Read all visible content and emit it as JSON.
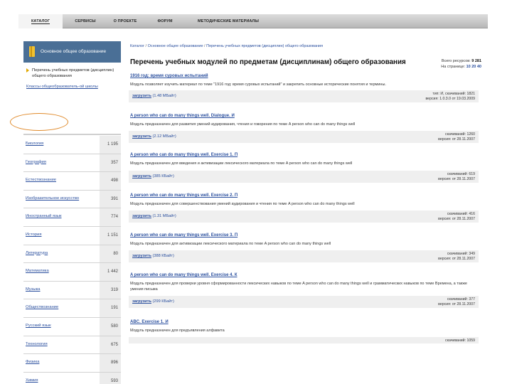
{
  "nav": {
    "tabs": [
      {
        "label": "КАТАЛОГ",
        "active": true
      },
      {
        "label": "СЕРВИСЫ",
        "active": false
      },
      {
        "label": "О ПРОЕКТЕ",
        "active": false
      },
      {
        "label": "ФОРУМ",
        "active": false
      },
      {
        "label": "МЕТОДИЧЕСКИЕ МАТЕРИАЛЫ",
        "active": false
      }
    ]
  },
  "sidebar": {
    "header": "Основное общее образование",
    "subitem": "Перечень учебных предметов (дисциплин) общего образования",
    "link": "Классы общеобразователь-ой школы",
    "subjects": [
      {
        "name": "Биология",
        "count": "1 195"
      },
      {
        "name": "География",
        "count": "357"
      },
      {
        "name": "Естествознание",
        "count": "498"
      },
      {
        "name": "Изобразительное искусство",
        "count": "391"
      },
      {
        "name": "Иностранный язык",
        "count": "774"
      },
      {
        "name": "История",
        "count": "1 151"
      },
      {
        "name": "Литература",
        "count": "80"
      },
      {
        "name": "Математика",
        "count": "1 442"
      },
      {
        "name": "Музыка",
        "count": "319"
      },
      {
        "name": "Обществознание",
        "count": "191"
      },
      {
        "name": "Русский язык",
        "count": "580"
      },
      {
        "name": "Технология",
        "count": "675"
      },
      {
        "name": "Физика",
        "count": "896"
      },
      {
        "name": "Химия",
        "count": "593"
      }
    ]
  },
  "breadcrumb": [
    "Каталог",
    "Основное общее образование",
    "Перечень учебных предметов (дисциплин) общего образования"
  ],
  "page_title": "Перечень учебных модулей по предметам (дисциплинам) общего образования",
  "stats": {
    "total_label": "Всего ресурсов:",
    "total": "9 281",
    "per_page_label": "На странице:",
    "p10": "10",
    "p20": "20",
    "p40": "40"
  },
  "items": [
    {
      "title": "1916 год: время суровых испытаний",
      "desc": "Модуль позволяет изучить материал по теме \"1916 год: время суровых испытаний\" и закрепить основные исторические понятия и термины.",
      "download": "загрузить",
      "size": "(1.48 МБайт)",
      "meta1": "тип: И, скачиваний: 1821",
      "meta2": "версия: 1.0.3.0 от 19.03.2009"
    },
    {
      "title": "A person who can do many things well. Dialogue. И",
      "desc": "Модуль предназначен для развития умений аудирования, чтения и говорения по теме A person who can do many things well",
      "download": "загрузить",
      "size": "(2.12 МБайт)",
      "meta1": "скачиваний: 1260",
      "meta2": "версия: от 28.11.2007"
    },
    {
      "title": "A person who can do many things well. Exercise 1. П",
      "desc": "Модуль предназначен для введения и активизации лексического материала по теме A person who can do many things well",
      "download": "загрузить",
      "size": "(385 КБайт)",
      "meta1": "скачиваний: 619",
      "meta2": "версия: от 28.11.2007"
    },
    {
      "title": "A person who can do many things well. Exercise 2. П",
      "desc": "Модуль предназначен для совершенствования умений аудирования и чтения по теме A person who can do many things well",
      "download": "загрузить",
      "size": "(1.31 МБайт)",
      "meta1": "скачиваний: 416",
      "meta2": "версия: от 28.11.2007"
    },
    {
      "title": "A person who can do many things well. Exercise 3. П",
      "desc": "Модуль предназначен для активизации лексического материала по теме A person who can do many things well",
      "download": "загрузить",
      "size": "(388 КБайт)",
      "meta1": "скачиваний: 349",
      "meta2": "версия: от 28.11.2007"
    },
    {
      "title": "A person who can do many things well. Exercise 4. К",
      "desc": "Модуль предназначен для проверки уровня сформированности лексических навыков по теме A person who can do many things well и грамматических навыков по теме Времена, а также умения письма",
      "download": "загрузить",
      "size": "(299 КБайт)",
      "meta1": "скачиваний: 377",
      "meta2": "версия: от 28.11.2007"
    },
    {
      "title": "ABC. Exercise 1. И",
      "desc": "Модуль предназначен для предъявления алфавита",
      "download": "",
      "size": "",
      "meta1": "скачиваний: 1059",
      "meta2": ""
    }
  ]
}
